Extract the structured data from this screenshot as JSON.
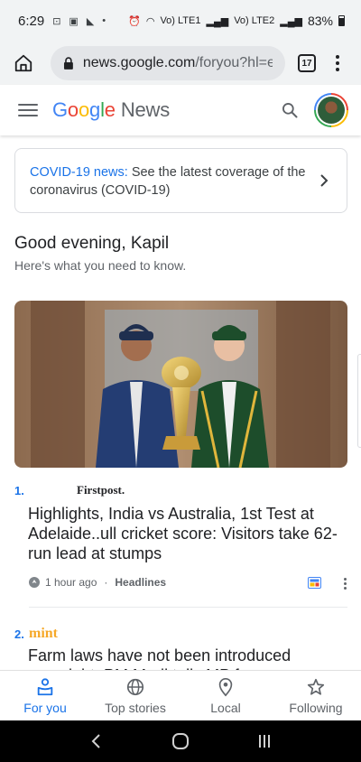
{
  "status_bar": {
    "time": "6:29",
    "battery": "83%",
    "network_1": "Vo) LTE1",
    "network_2": "Vo) LTE2"
  },
  "browser": {
    "url_host": "news.google.com",
    "url_path": "/foryou?hl=e",
    "tab_count": "17"
  },
  "app": {
    "logo_google": [
      "G",
      "o",
      "o",
      "g",
      "l",
      "e"
    ],
    "logo_news": "News"
  },
  "covid_banner": {
    "highlight": "COVID-19 news:",
    "text": " See the latest coverage of the coronavirus (COVID-19)"
  },
  "greeting": {
    "title": "Good evening, Kapil",
    "subtitle": "Here's what you need to know."
  },
  "articles": [
    {
      "rank": "1.",
      "source": "Firstpost.",
      "headline": "Highlights, India vs Australia, 1st Test at Adelaide..ull cricket score: Visitors take 62-run lead at stumps",
      "time": "1 hour ago",
      "separator": "·",
      "section": "Headlines"
    },
    {
      "rank": "2.",
      "source": "mint",
      "headline": "Farm laws have not been introduced overnight: PM Modi tells MP farmers"
    }
  ],
  "bottom_nav": [
    {
      "label": "For you",
      "icon": "for-you-icon",
      "active": true
    },
    {
      "label": "Top stories",
      "icon": "globe-icon",
      "active": false
    },
    {
      "label": "Local",
      "icon": "location-pin-icon",
      "active": false
    },
    {
      "label": "Following",
      "icon": "star-icon",
      "active": false
    }
  ],
  "colors": {
    "accent_blue": "#1a73e8",
    "mint_orange": "#f6a828"
  }
}
